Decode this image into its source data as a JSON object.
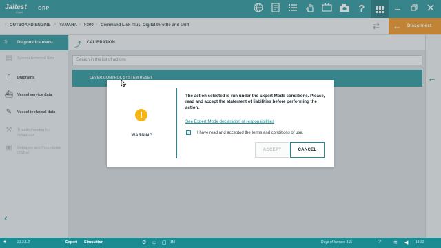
{
  "topbar": {
    "logo": "Jaltest",
    "logo_sub": "Cojali",
    "product": "GRP",
    "icons": [
      "globe-icon",
      "document-icon",
      "checklist-icon",
      "hand-icon",
      "battery-icon",
      "camera-icon",
      "help-icon"
    ],
    "window_buttons": [
      "apps-grid-icon",
      "minimize-icon",
      "restore-icon",
      "close-icon"
    ]
  },
  "breadcrumb": {
    "items": [
      "OUTBOARD ENGINE",
      "YAMAHA",
      "F300",
      "Command Link Plus. Digital throttle and shift"
    ],
    "disconnect_label": "Disconnect"
  },
  "sidebar": {
    "header": "Diagnostics menu",
    "items": [
      {
        "label": "System technical data",
        "icon": "document-icon",
        "enabled": false
      },
      {
        "label": "Diagrams",
        "icon": "diagram-icon",
        "enabled": true
      },
      {
        "label": "Vessel service data",
        "icon": "boat-icon",
        "enabled": true
      },
      {
        "label": "Vessel technical data",
        "icon": "wrench-icon",
        "enabled": true
      },
      {
        "label": "Troubleshooting by symptoms",
        "icon": "troubleshoot-icon",
        "enabled": false
      },
      {
        "label": "Releases and Procedures (TSBs)",
        "icon": "tsb-icon",
        "enabled": false
      }
    ]
  },
  "main": {
    "section_title": "CALIBRATION",
    "search_placeholder": "Search in the list of actions",
    "list": [
      "LEVER CONTROL SYSTEM RESET"
    ]
  },
  "modal": {
    "warning_label": "WARNING",
    "message": "The action selected is run under the Expert Mode conditions. Please, read and accept the statement of liabilities before performing the action.",
    "link_text": "See Expert Mode declaration of responsibilities",
    "checkbox_label": "I have read and accepted the terms and conditions of use.",
    "checkbox_checked": false,
    "accept_label": "ACCEPT",
    "cancel_label": "CANCEL",
    "accept_enabled": false
  },
  "statusbar": {
    "version": "21.3.1.2",
    "mode": "Expert",
    "simulation": "Simulation",
    "extra": "1M",
    "license": "Days of license: 315",
    "clock": "18:32"
  },
  "colors": {
    "brand": "#1b8c92",
    "accent": "#ef8a12",
    "warning": "#f5b514"
  }
}
